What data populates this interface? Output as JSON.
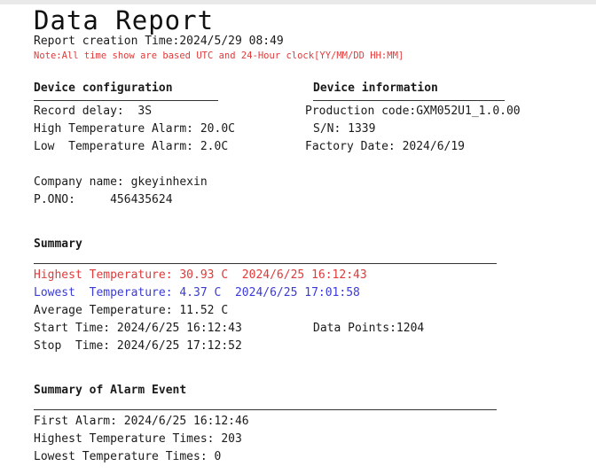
{
  "report": {
    "title": "Data Report",
    "creation_time": "Report creation Time:2024/5/29 08:49",
    "note": "Note:All time show are based UTC and 24-Hour clock[YY/MM/DD HH:MM]"
  },
  "device_configuration": {
    "heading": "Device configuration",
    "record_delay": "Record delay:  3S",
    "high_alarm": "High Temperature Alarm: 20.0C",
    "low_alarm": "Low  Temperature Alarm: 2.0C"
  },
  "device_information": {
    "heading": "Device information",
    "production_code": "Production code:GXM052U1_1.0.00",
    "sn": "S/N: 1339",
    "factory_date": "Factory Date: 2024/6/19"
  },
  "company": {
    "name": "Company name: gkeyinhexin",
    "po": "P.ONO:     456435624"
  },
  "summary": {
    "heading": "Summary",
    "highest": "Highest Temperature: 30.93 C  2024/6/25 16:12:43",
    "lowest": "Lowest  Temperature: 4.37 C  2024/6/25 17:01:58",
    "average": "Average Temperature: 11.52 C",
    "start": "Start Time: 2024/6/25 16:12:43",
    "data_points": "Data Points:1204",
    "stop": "Stop  Time: 2024/6/25 17:12:52"
  },
  "alarm_summary": {
    "heading": "Summary of Alarm Event",
    "first_alarm": "First Alarm: 2024/6/25 16:12:46",
    "highest_times": "Highest Temperature Times: 203",
    "lowest_times": "Lowest Temperature Times: 0"
  },
  "colors": {
    "highest": "#e03a3a",
    "lowest": "#3a3ad8",
    "note": "#e03a3a"
  }
}
